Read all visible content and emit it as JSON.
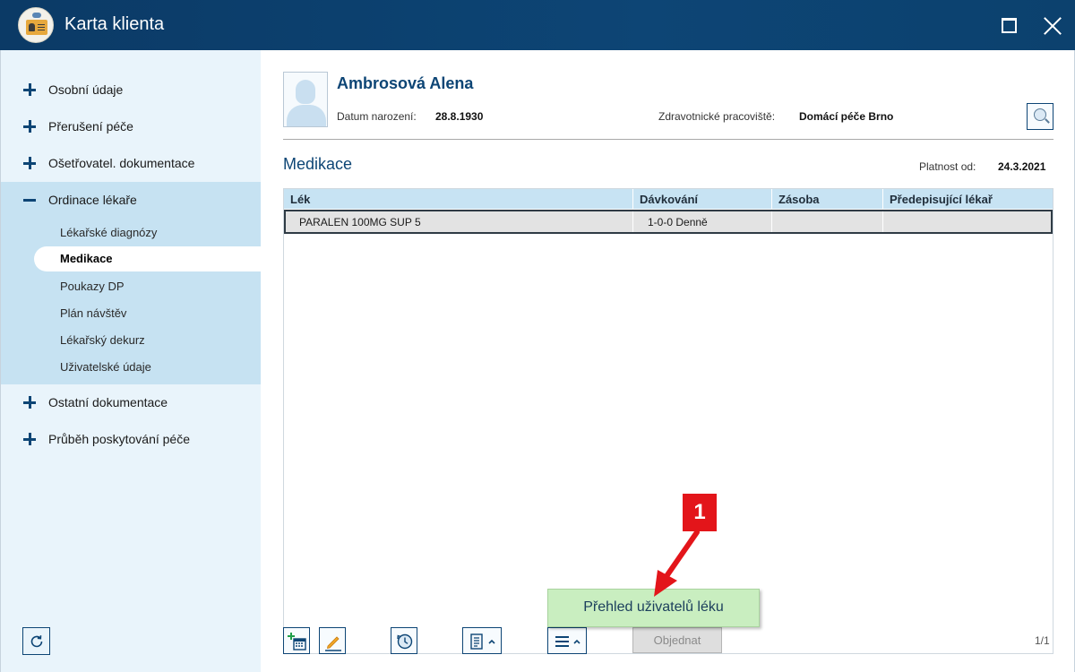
{
  "window": {
    "title": "Karta klienta"
  },
  "sidebar": {
    "items": [
      {
        "label": "Osobní údaje",
        "expanded": false
      },
      {
        "label": "Přerušení péče",
        "expanded": false
      },
      {
        "label": "Ošetřovatel. dokumentace",
        "expanded": false
      },
      {
        "label": "Ordinace lékaře",
        "expanded": true
      },
      {
        "label": "Ostatní dokumentace",
        "expanded": false
      },
      {
        "label": "Průběh poskytování péče",
        "expanded": false
      }
    ],
    "sub_items": [
      "Lékařské diagnózy",
      "Medikace",
      "Poukazy DP",
      "Plán návštěv",
      "Lékařský dekurz",
      "Uživatelské údaje"
    ],
    "active_sub_item": "Medikace"
  },
  "patient": {
    "name": "Ambrosová Alena",
    "dob_label": "Datum narození:",
    "dob": "28.8.1930",
    "workplace_label": "Zdravotnické pracoviště:",
    "workplace": "Domácí péče Brno"
  },
  "section": {
    "title": "Medikace",
    "valid_label": "Platnost od:",
    "valid_from": "24.3.2021"
  },
  "table": {
    "columns": [
      "Lék",
      "Dávkování",
      "Zásoba",
      "Předepisující lékař"
    ],
    "rows": [
      [
        "PARALEN 100MG SUP 5",
        "1-0-0 Denně",
        "",
        ""
      ]
    ]
  },
  "toolbar": {
    "order_label": "Objednat",
    "order_enabled": false,
    "page_indicator": "1/1",
    "icons": [
      "add-calendar-icon",
      "edit-pencil-icon",
      "history-clock-icon",
      "document-menu-icon",
      "hamburger-menu-icon"
    ]
  },
  "tooltip": {
    "label": "Přehled uživatelů léku"
  },
  "annotation": {
    "badge": "1",
    "color": "#e3151a"
  },
  "colors": {
    "titlebar": "#0d4575",
    "sidebar": "#e9f4fb",
    "sidebar_expanded": "#c6e2f2",
    "table_header": "#c7e3f3",
    "tooltip": "#c9eec0"
  }
}
